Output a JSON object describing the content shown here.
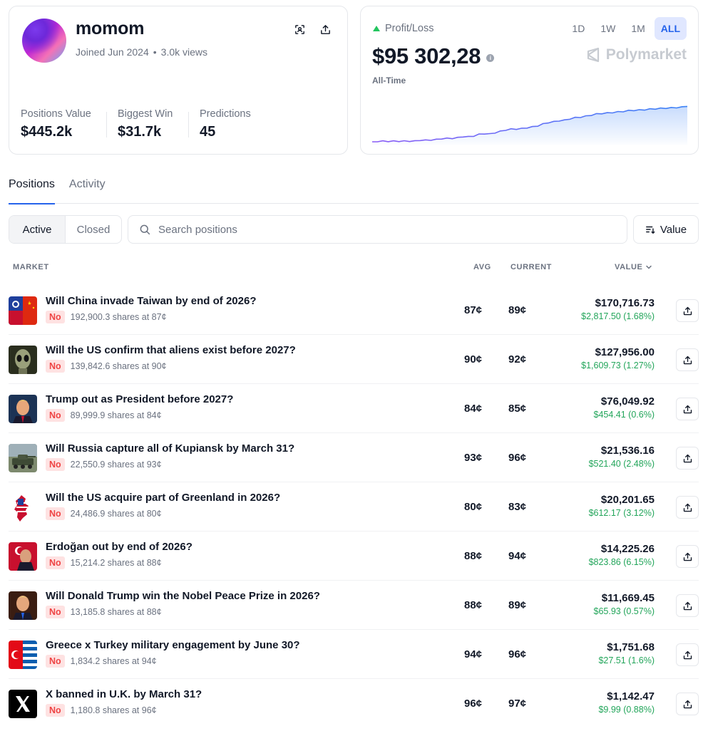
{
  "profile": {
    "username": "momom",
    "joined": "Joined Jun 2024",
    "separator": "•",
    "views": "3.0k views",
    "stats": [
      {
        "label": "Positions Value",
        "value": "$445.2k"
      },
      {
        "label": "Biggest Win",
        "value": "$31.7k"
      },
      {
        "label": "Predictions",
        "value": "45"
      }
    ]
  },
  "pnl": {
    "label": "Profit/Loss",
    "value": "$95 302,28",
    "sub": "All-Time",
    "ranges": [
      "1D",
      "1W",
      "1M",
      "ALL"
    ],
    "active_range": "ALL",
    "brand": "Polymarket",
    "info_icon": "i"
  },
  "chart_data": {
    "type": "line",
    "title": "",
    "xlabel": "",
    "ylabel": "",
    "series": [
      {
        "values": [
          0,
          1200,
          1500,
          1400,
          1500,
          1600,
          1700,
          1800,
          1900,
          4500,
          4000,
          5000,
          6000,
          8500,
          9000,
          9500,
          11000,
          14000,
          13500,
          15500,
          20000,
          22000,
          21000,
          24500,
          28000,
          32000,
          34000,
          34500,
          35500,
          38000,
          40000,
          43000,
          48000,
          52000,
          54000,
          57000,
          58000,
          62000,
          65000,
          66500,
          69000,
          72000,
          75000,
          76500,
          77500,
          79000,
          80500,
          82000,
          84000,
          85000,
          85500,
          86500,
          88000,
          89000,
          90000,
          91000,
          91500,
          92500,
          93500,
          95302.28
        ]
      }
    ],
    "ylim": [
      0,
      100000
    ],
    "color_start": "#8b5cf6",
    "color_end": "#3b82f6"
  },
  "tabs": [
    "Positions",
    "Activity"
  ],
  "filters": {
    "active_label": "Active",
    "closed_label": "Closed",
    "search_placeholder": "Search positions",
    "sort_label": "Value"
  },
  "table": {
    "headers": {
      "market": "MARKET",
      "avg": "AVG",
      "current": "CURRENT",
      "value": "VALUE"
    },
    "rows": [
      {
        "title": "Will China invade Taiwan by end of 2026?",
        "outcome": "No",
        "shares": "192,900.3 shares at 87¢",
        "avg": "87¢",
        "current": "89¢",
        "value": "$170,716.73",
        "pnl": "$2,817.50 (1.68%)"
      },
      {
        "title": "Will the US confirm that aliens exist before 2027?",
        "outcome": "No",
        "shares": "139,842.6 shares at 90¢",
        "avg": "90¢",
        "current": "92¢",
        "value": "$127,956.00",
        "pnl": "$1,609.73 (1.27%)"
      },
      {
        "title": "Trump out as President before 2027?",
        "outcome": "No",
        "shares": "89,999.9 shares at 84¢",
        "avg": "84¢",
        "current": "85¢",
        "value": "$76,049.92",
        "pnl": "$454.41 (0.6%)"
      },
      {
        "title": "Will Russia capture all of Kupiansk by March 31?",
        "outcome": "No",
        "shares": "22,550.9 shares at 93¢",
        "avg": "93¢",
        "current": "96¢",
        "value": "$21,536.16",
        "pnl": "$521.40 (2.48%)"
      },
      {
        "title": "Will the US acquire part of Greenland in 2026?",
        "outcome": "No",
        "shares": "24,486.9 shares at 80¢",
        "avg": "80¢",
        "current": "83¢",
        "value": "$20,201.65",
        "pnl": "$612.17 (3.12%)"
      },
      {
        "title": "Erdoğan out by end of 2026?",
        "outcome": "No",
        "shares": "15,214.2 shares at 88¢",
        "avg": "88¢",
        "current": "94¢",
        "value": "$14,225.26",
        "pnl": "$823.86 (6.15%)"
      },
      {
        "title": "Will Donald Trump win the Nobel Peace Prize in 2026?",
        "outcome": "No",
        "shares": "13,185.8 shares at 88¢",
        "avg": "88¢",
        "current": "89¢",
        "value": "$11,669.45",
        "pnl": "$65.93 (0.57%)"
      },
      {
        "title": "Greece x Turkey military engagement by June 30?",
        "outcome": "No",
        "shares": "1,834.2 shares at 94¢",
        "avg": "94¢",
        "current": "96¢",
        "value": "$1,751.68",
        "pnl": "$27.51 (1.6%)"
      },
      {
        "title": "X banned in U.K. by March 31?",
        "outcome": "No",
        "shares": "1,180.8 shares at 96¢",
        "avg": "96¢",
        "current": "97¢",
        "value": "$1,142.47",
        "pnl": "$9.99 (0.88%)"
      }
    ]
  },
  "icons": {
    "scan": "scan-icon",
    "share": "share-icon",
    "search": "search-icon",
    "sort": "sort-icon",
    "chevron": "chevron-down-icon",
    "brand": "polymarket-logo-icon"
  },
  "colors": {
    "accent": "#2563eb",
    "positive": "#22a55a",
    "negative_badge_bg": "#fee2e2",
    "negative_badge_text": "#ef4444"
  }
}
